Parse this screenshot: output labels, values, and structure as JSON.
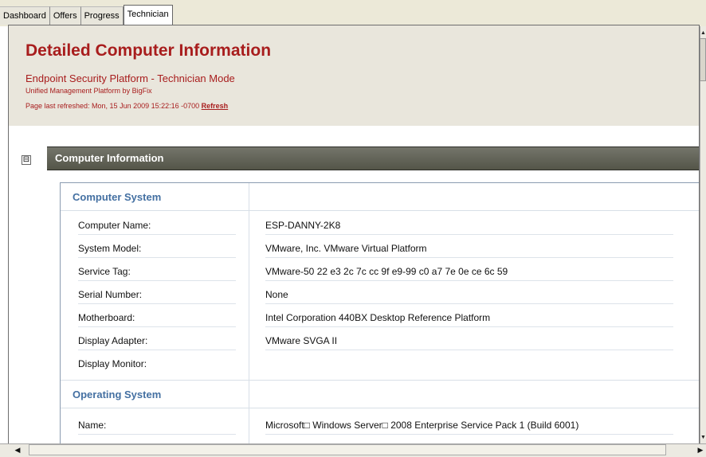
{
  "tabs": [
    {
      "label": "Dashboard"
    },
    {
      "label": "Offers"
    },
    {
      "label": "Progress"
    },
    {
      "label": "Technician"
    }
  ],
  "header": {
    "title": "Detailed Computer Information",
    "subtitle": "Endpoint Security Platform - Technician Mode",
    "tagline": "Unified Management Platform by BigFix",
    "refreshed_text": "Page last refreshed: Mon, 15 Jun 2009 15:22:16 -0700",
    "refresh_link": "Refresh"
  },
  "section": {
    "collapse_glyph": "⊟",
    "title": "Computer Information"
  },
  "groups": {
    "computer_system": {
      "title": "Computer System",
      "rows": [
        {
          "label": "Computer Name:",
          "value": "ESP-DANNY-2K8"
        },
        {
          "label": "System Model:",
          "value": "VMware, Inc. VMware Virtual Platform"
        },
        {
          "label": "Service Tag:",
          "value": "VMware-50 22 e3 2c 7c cc 9f e9-99 c0 a7 7e 0e ce 6c 59"
        },
        {
          "label": "Serial Number:",
          "value": "None"
        },
        {
          "label": "Motherboard:",
          "value": "Intel Corporation 440BX Desktop Reference Platform"
        },
        {
          "label": "Display Adapter:",
          "value": "VMware SVGA II"
        },
        {
          "label": "Display Monitor:",
          "value": ""
        }
      ]
    },
    "operating_system": {
      "title": "Operating System",
      "rows": [
        {
          "label": "Name:",
          "value": "Microsoft□ Windows Server□ 2008 Enterprise Service Pack 1 (Build 6001)"
        }
      ]
    }
  },
  "scrollbars": {
    "left_arrow": "◀",
    "right_arrow": "▶",
    "up_arrow": "▲",
    "down_arrow": "▼"
  },
  "colors": {
    "title_red": "#a81d1d",
    "group_blue": "#4470a2",
    "section_bar": "#5f5f55"
  }
}
